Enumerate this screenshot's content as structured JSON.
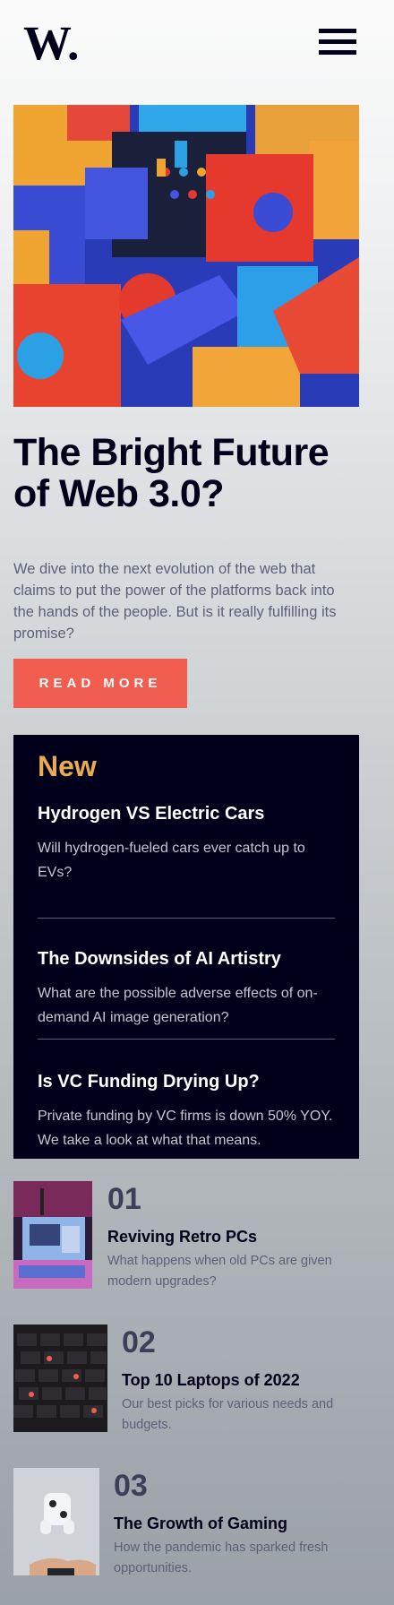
{
  "brand": {
    "logo_text": "W."
  },
  "header": {
    "menu_icon": "hamburger-menu-icon"
  },
  "hero": {
    "headline": "The Bright Future of Web 3.0?",
    "intro": "We dive into the next evolution of the web that claims to put the power of the platforms back into the hands of the people. But is it really fulfilling its promise?",
    "cta_label": "READ MORE"
  },
  "new_section": {
    "title": "New",
    "items": [
      {
        "title": "Hydrogen VS Electric Cars",
        "desc": "Will hydrogen-fueled cars ever catch up to EVs?"
      },
      {
        "title": "The Downsides of AI Artistry",
        "desc": "What are the possible adverse effects of on-demand AI image generation?"
      },
      {
        "title": "Is VC Funding Drying Up?",
        "desc": "Private funding by VC firms is down 50% YOY. We take a look at what that means."
      }
    ]
  },
  "trending": [
    {
      "number": "01",
      "title": "Reviving Retro PCs",
      "desc": "What happens when old PCs are given modern upgrades?"
    },
    {
      "number": "02",
      "title": "Top 10 Laptops of 2022",
      "desc": "Our best picks for various needs and budgets."
    },
    {
      "number": "03",
      "title": "The Growth of Gaming",
      "desc": "How the pandemic has sparked fresh opportunities."
    }
  ],
  "colors": {
    "dark_navy": "#00001a",
    "accent_red": "#f15e50",
    "accent_orange": "#e9ab53",
    "grayish_blue": "#5d5f79"
  }
}
